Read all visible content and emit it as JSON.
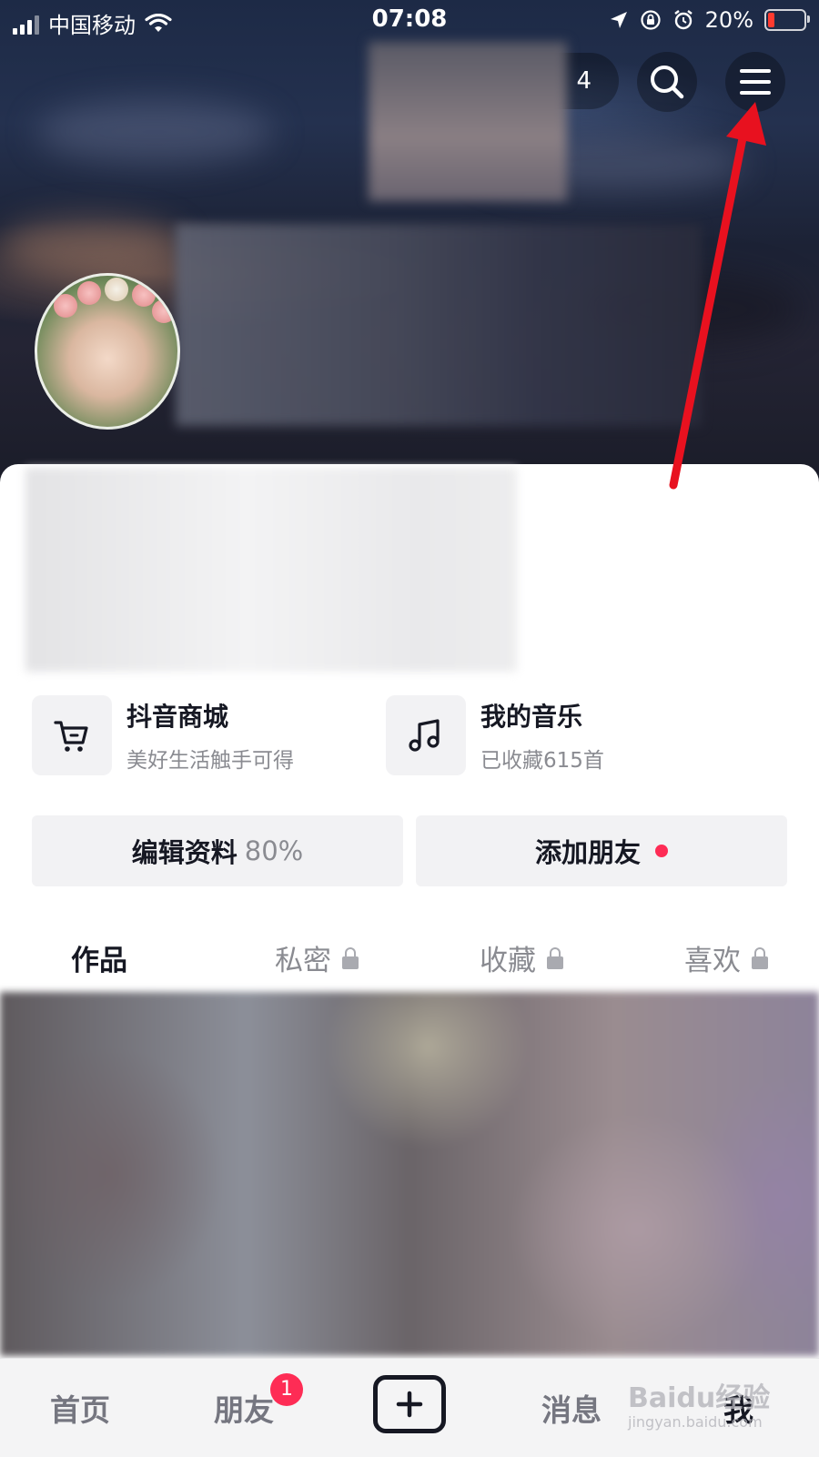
{
  "status_bar": {
    "carrier": "中国移动",
    "time": "07:08",
    "battery": "20%",
    "battery_level": 0.2
  },
  "header": {
    "visitors_label": "4"
  },
  "features": [
    {
      "title": "抖音商城",
      "subtitle": "美好生活触手可得",
      "icon": "cart-icon"
    },
    {
      "title": "我的音乐",
      "subtitle": "已收藏615首",
      "icon": "music-note-icon"
    }
  ],
  "actions": {
    "edit_profile": "编辑资料",
    "edit_profile_percent": "80%",
    "add_friend": "添加朋友"
  },
  "tabs": [
    {
      "label": "作品",
      "active": true,
      "locked": false
    },
    {
      "label": "私密",
      "active": false,
      "locked": true
    },
    {
      "label": "收藏",
      "active": false,
      "locked": true
    },
    {
      "label": "喜欢",
      "active": false,
      "locked": true
    }
  ],
  "bottom_nav": {
    "home": "首页",
    "friends": "朋友",
    "friends_badge": "1",
    "messages": "消息",
    "me": "我"
  },
  "watermark": {
    "text": "Baidu经验",
    "sub": "jingyan.baidu.com"
  },
  "colors": {
    "accent": "#fe2c55",
    "arrow": "#e8111f",
    "text_primary": "#161823",
    "text_secondary": "#8a8b91"
  }
}
